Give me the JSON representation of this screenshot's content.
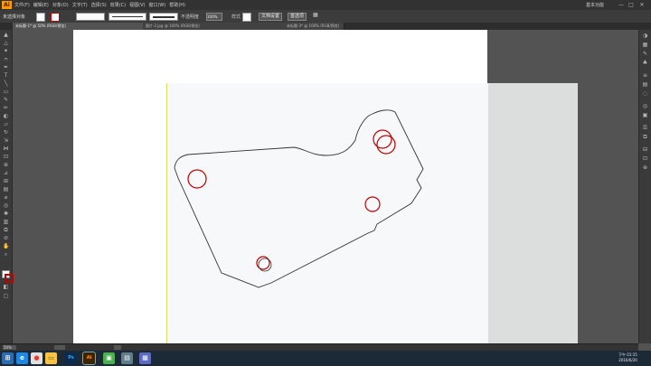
{
  "app": {
    "logo": "Ai"
  },
  "menubar": {
    "items": [
      "文件(F)",
      "编辑(E)",
      "对象(O)",
      "文字(T)",
      "选择(S)",
      "效果(C)",
      "视图(V)",
      "窗口(W)",
      "帮助(H)"
    ],
    "workspace": "基本功能",
    "win_min": "—",
    "win_max": "□",
    "win_close": "✕"
  },
  "controlbar": {
    "selection_label": "未选择对象",
    "opacity_label": "不透明度",
    "opacity_value": "100%",
    "style_label": "样式",
    "doc_setup_btn": "文档设置",
    "prefs_btn": "首选项"
  },
  "tabs": [
    {
      "label": "未标题-1* @ 50% (RGB/预览)",
      "active": true
    },
    {
      "label": "图片-2.jpg @ 100% (RGB/预览)",
      "active": false
    },
    {
      "label": "未标题-3* @ 100% (RGB/预览)",
      "active": false
    }
  ],
  "statusbar": {
    "zoom": "50%"
  },
  "taskbar": {
    "apps": [
      {
        "name": "start",
        "glyph": "⊞",
        "color": "#2b6cb0"
      },
      {
        "name": "ie",
        "glyph": "e",
        "color": "#1e88e5"
      },
      {
        "name": "chrome",
        "glyph": "●",
        "color": "#e53935"
      },
      {
        "name": "explorer",
        "glyph": "▭",
        "color": "#f6c343"
      },
      {
        "name": "photoshop",
        "glyph": "Ps",
        "color": "#0d2b4a"
      },
      {
        "name": "illustrator",
        "glyph": "Ai",
        "color": "#3d2300"
      },
      {
        "name": "app6",
        "glyph": "▣",
        "color": "#4caf50"
      },
      {
        "name": "app7",
        "glyph": "▤",
        "color": "#607d8b"
      },
      {
        "name": "app8",
        "glyph": "▦",
        "color": "#5c6bc0"
      }
    ],
    "time": "下午 01:15",
    "date": "2016/6/20"
  },
  "colors": {
    "accent": "#ff9a00",
    "circle": "#c00000",
    "outline": "#333333"
  }
}
